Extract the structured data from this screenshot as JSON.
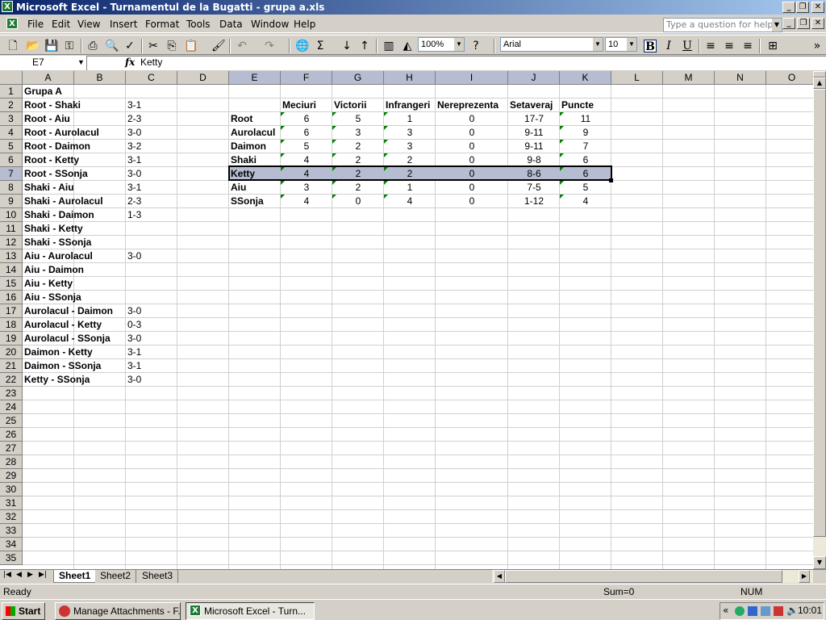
{
  "window": {
    "title": "Microsoft Excel - Turnamentul de la Bugatti - grupa a.xls"
  },
  "menu": [
    "File",
    "Edit",
    "View",
    "Insert",
    "Format",
    "Tools",
    "Data",
    "Window",
    "Help"
  ],
  "help_placeholder": "Type a question for help",
  "toolbar": {
    "zoom": "100%",
    "font": "Arial",
    "size": "10",
    "bold": "B",
    "italic": "I",
    "underline": "U"
  },
  "formula": {
    "name_box": "E7",
    "fx": "fx",
    "value": "Ketty"
  },
  "columns": [
    "A",
    "B",
    "C",
    "D",
    "E",
    "F",
    "G",
    "H",
    "I",
    "J",
    "K",
    "L",
    "M",
    "N",
    "O"
  ],
  "rows": [
    "1",
    "2",
    "3",
    "4",
    "5",
    "6",
    "7",
    "8",
    "9",
    "10",
    "11",
    "12",
    "13",
    "14",
    "15",
    "16",
    "17",
    "18",
    "19",
    "20",
    "21",
    "22",
    "23",
    "24",
    "25",
    "26",
    "27",
    "28",
    "29",
    "30",
    "31",
    "32",
    "33",
    "34",
    "35"
  ],
  "group_title": "Grupa A",
  "matches": [
    {
      "pair": "Root - Shaki",
      "score": "3-1"
    },
    {
      "pair": "Root - Aiu",
      "score": "2-3"
    },
    {
      "pair": "Root - Aurolacul",
      "score": "3-0"
    },
    {
      "pair": "Root - Daimon",
      "score": "3-2"
    },
    {
      "pair": "Root - Ketty",
      "score": "3-1"
    },
    {
      "pair": "Root - SSonja",
      "score": "3-0"
    },
    {
      "pair": "Shaki - Aiu",
      "score": "3-1"
    },
    {
      "pair": "Shaki - Aurolacul",
      "score": "2-3"
    },
    {
      "pair": "Shaki - Daimon",
      "score": "1-3"
    },
    {
      "pair": "Shaki - Ketty",
      "score": ""
    },
    {
      "pair": "Shaki - SSonja",
      "score": ""
    },
    {
      "pair": "Aiu - Aurolacul",
      "score": "3-0"
    },
    {
      "pair": "Aiu - Daimon",
      "score": ""
    },
    {
      "pair": "Aiu - Ketty",
      "score": ""
    },
    {
      "pair": "Aiu - SSonja",
      "score": ""
    },
    {
      "pair": "Aurolacul - Daimon",
      "score": "3-0"
    },
    {
      "pair": "Aurolacul - Ketty",
      "score": "0-3"
    },
    {
      "pair": "Aurolacul - SSonja",
      "score": "3-0"
    },
    {
      "pair": "Daimon - Ketty",
      "score": "3-1"
    },
    {
      "pair": "Daimon - SSonja",
      "score": "3-1"
    },
    {
      "pair": "Ketty - SSonja",
      "score": "3-0"
    }
  ],
  "standings_headers": [
    "Meciuri",
    "Victorii",
    "Infrangeri",
    "Nereprezenta",
    "Setaveraj",
    "Puncte"
  ],
  "standings": [
    {
      "name": "Root",
      "v": [
        "6",
        "5",
        "1",
        "0",
        "17-7",
        "11"
      ]
    },
    {
      "name": "Aurolacul",
      "v": [
        "6",
        "3",
        "3",
        "0",
        "9-11",
        "9"
      ]
    },
    {
      "name": "Daimon",
      "v": [
        "5",
        "2",
        "3",
        "0",
        "9-11",
        "7"
      ]
    },
    {
      "name": "Shaki",
      "v": [
        "4",
        "2",
        "2",
        "0",
        "9-8",
        "6"
      ]
    },
    {
      "name": "Ketty",
      "v": [
        "4",
        "2",
        "2",
        "0",
        "8-6",
        "6"
      ]
    },
    {
      "name": "Aiu",
      "v": [
        "3",
        "2",
        "1",
        "0",
        "7-5",
        "5"
      ]
    },
    {
      "name": "SSonja",
      "v": [
        "4",
        "0",
        "4",
        "0",
        "1-12",
        "4"
      ]
    }
  ],
  "sheets": [
    "Sheet1",
    "Sheet2",
    "Sheet3"
  ],
  "status": {
    "ready": "Ready",
    "sum": "Sum=0",
    "num": "NUM"
  },
  "taskbar": {
    "start": "Start",
    "tasks": [
      "Manage Attachments - F...",
      "Microsoft Excel - Turn..."
    ],
    "clock": "10:01"
  }
}
